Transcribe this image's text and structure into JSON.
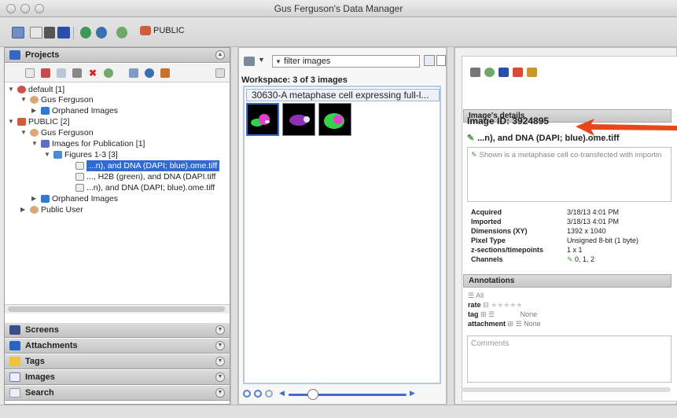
{
  "window": {
    "title": "Gus Ferguson's Data Manager"
  },
  "toolbar": {
    "public_label": "PUBLIC"
  },
  "left": {
    "projects_title": "Projects",
    "tree": [
      {
        "label": "default [1]",
        "level": 0,
        "expanded": true
      },
      {
        "label": "Gus Ferguson",
        "level": 1,
        "expanded": true
      },
      {
        "label": "Orphaned Images",
        "level": 2,
        "expanded": false
      },
      {
        "label": "PUBLIC [2]",
        "level": 0,
        "expanded": true
      },
      {
        "label": "Gus Ferguson",
        "level": 1,
        "expanded": true
      },
      {
        "label": "Images for Publication [1]",
        "level": 2,
        "expanded": true
      },
      {
        "label": "Figures 1-3 [3]",
        "level": 3,
        "expanded": true
      },
      {
        "label": "...n), and DNA (DAPI; blue).ome.tiff",
        "level": 4,
        "selected": true
      },
      {
        "label": "..., H2B (green), and DNA (DAPI.tiff",
        "level": 4
      },
      {
        "label": "...n), and DNA (DAPI; blue).ome.tiff",
        "level": 4
      },
      {
        "label": "Orphaned Images",
        "level": 2,
        "expanded": false
      },
      {
        "label": "Public User",
        "level": 1,
        "expanded": false
      }
    ],
    "sections": [
      {
        "label": "Screens"
      },
      {
        "label": "Attachments"
      },
      {
        "label": "Tags"
      },
      {
        "label": "Images"
      },
      {
        "label": "Search"
      }
    ]
  },
  "middle": {
    "filter_text": "filter images",
    "workspace_label": "Workspace: 3 of 3 images",
    "selected_title": "30630-A metaphase cell expressing full-l..."
  },
  "right": {
    "details_header": "Image's details",
    "image_id": "Image ID: 3924895",
    "image_name": "...n), and DNA (DAPI; blue).ome.tiff",
    "description": "Shown is a metaphase cell co-transfected with importin",
    "meta": [
      {
        "key": "Acquired",
        "value": "3/18/13 4:01 PM"
      },
      {
        "key": "Imported",
        "value": "3/18/13 4:01 PM"
      },
      {
        "key": "Dimensions (XY)",
        "value": "1392 x 1040"
      },
      {
        "key": "Pixel Type",
        "value": "Unsigned 8-bit (1 byte)"
      },
      {
        "key": "z-sections/timepoints",
        "value": "1 x 1"
      },
      {
        "key": "Channels",
        "value": "0, 1, 2"
      }
    ],
    "annotations_header": "Annotations",
    "ann_all": "All",
    "rate_label": "rate",
    "tag_label": "tag",
    "tag_value": "None",
    "attachment_label": "attachment",
    "attachment_value": "None",
    "comments_placeholder": "Comments"
  },
  "colors": {
    "selection": "#2f6bd2",
    "arrow": "#e8461c"
  }
}
